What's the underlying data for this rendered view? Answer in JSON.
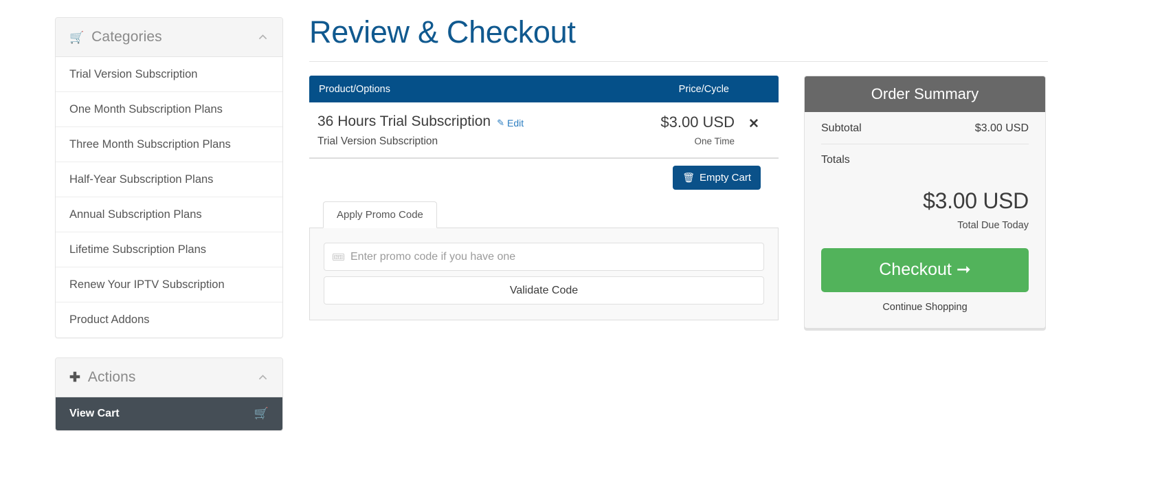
{
  "sidebar": {
    "categories_panel": {
      "title": "Categories",
      "icon": "shopping-cart-icon",
      "collapse_icon": "chevron-up-icon",
      "items": [
        {
          "label": "Trial Version Subscription"
        },
        {
          "label": "One Month Subscription Plans"
        },
        {
          "label": "Three Month Subscription Plans"
        },
        {
          "label": "Half-Year Subscription Plans"
        },
        {
          "label": "Annual Subscription Plans"
        },
        {
          "label": "Lifetime Subscription Plans"
        },
        {
          "label": "Renew Your IPTV Subscription"
        },
        {
          "label": "Product Addons"
        }
      ]
    },
    "actions_panel": {
      "title": "Actions",
      "icon": "plus-icon",
      "collapse_icon": "chevron-up-icon",
      "items": [
        {
          "label": "View Cart",
          "icon": "shopping-cart-icon"
        }
      ]
    }
  },
  "main": {
    "page_title": "Review & Checkout",
    "table": {
      "headers": {
        "product": "Product/Options",
        "price": "Price/Cycle"
      },
      "rows": [
        {
          "name": "36 Hours Trial Subscription",
          "edit_label": "Edit",
          "edit_icon": "pencil-icon",
          "description": "Trial Version Subscription",
          "price": "$3.00 USD",
          "cycle": "One Time",
          "remove_icon": "close-icon"
        }
      ]
    },
    "empty_cart_button": {
      "label": "Empty Cart",
      "icon": "trash-icon"
    },
    "promo": {
      "tab_label": "Apply Promo Code",
      "input_value": "",
      "input_placeholder": "Enter promo code if you have one",
      "input_icon": "ticket-icon",
      "validate_label": "Validate Code"
    }
  },
  "order_summary": {
    "title": "Order Summary",
    "subtotal_label": "Subtotal",
    "subtotal_value": "$3.00 USD",
    "totals_label": "Totals",
    "total_amount": "$3.00 USD",
    "total_caption": "Total Due Today",
    "checkout_label": "Checkout",
    "checkout_icon": "arrow-right-icon",
    "continue_label": "Continue Shopping"
  },
  "colors": {
    "brand_blue": "#055089",
    "title_blue": "#10598f",
    "link_blue": "#2b7dc1",
    "summary_header_gray": "#686868",
    "checkout_green": "#52b35b",
    "action_dark": "#454e56"
  }
}
